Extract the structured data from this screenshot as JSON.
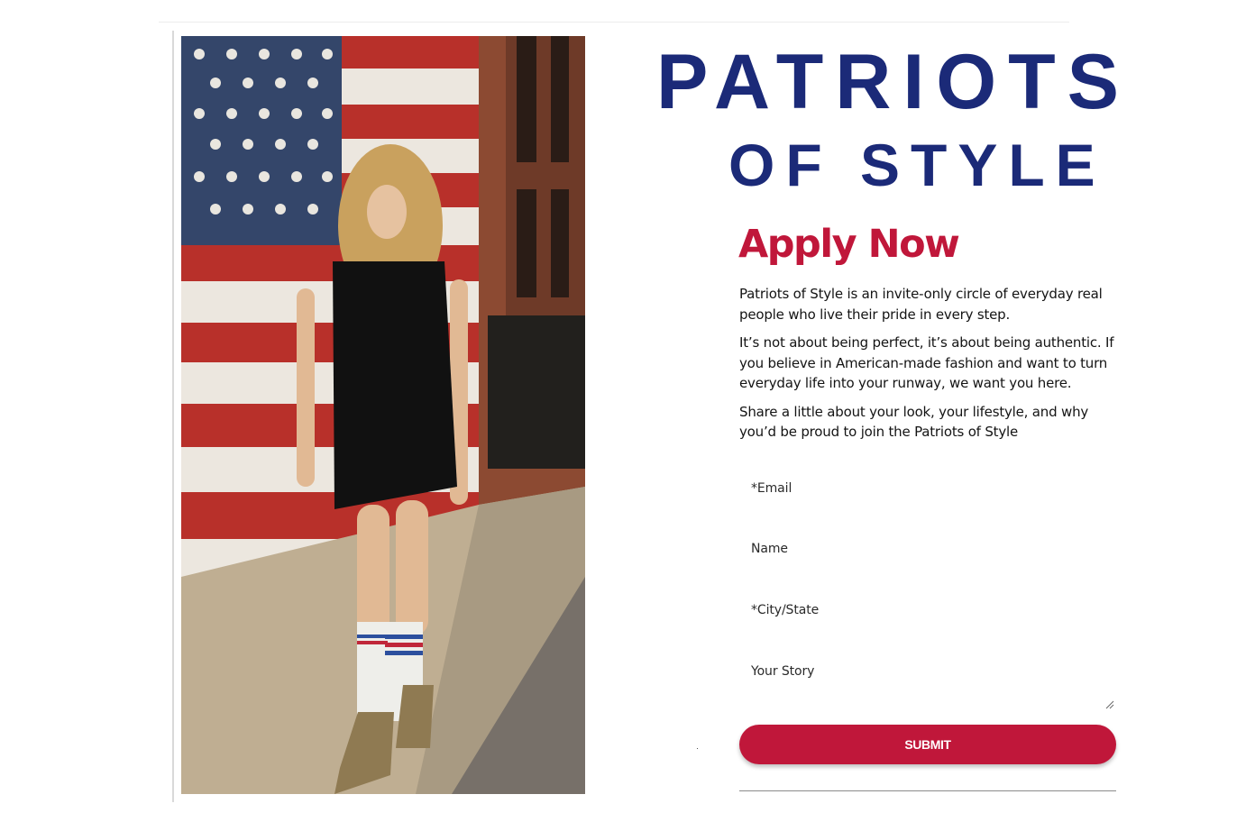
{
  "brand": {
    "line1": "PATRIOTS",
    "line2": "OF STYLE",
    "color": "#1b2a78"
  },
  "apply": {
    "title": "Apply Now",
    "accent_color": "#c0173a"
  },
  "intro": {
    "paragraphs": [
      "Patriots of Style is an invite-only circle of everyday real people who live their pride in every step.",
      "It’s not about being perfect, it’s about being authentic. If you believe in American-made fashion and want to turn everyday life into your runway, we want you here.",
      "Share a little about your look, your lifestyle, and why you’d be proud to join the Patriots of Style"
    ]
  },
  "form": {
    "email_label": "*Email",
    "name_label": "Name",
    "city_label": "*City/State",
    "story_label": "Your Story",
    "submit_label": "SUBMIT"
  }
}
